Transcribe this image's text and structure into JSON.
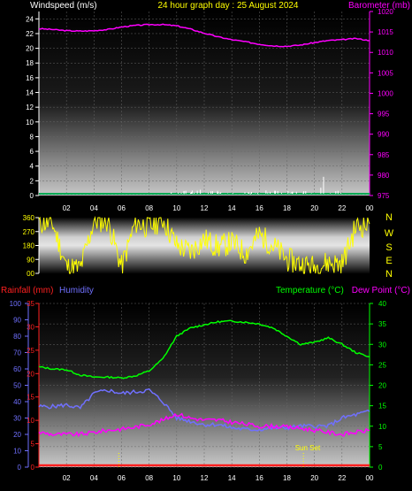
{
  "header": {
    "left": "Windspeed (m/s)",
    "center": "24 hour graph day : 25 August 2024",
    "right": "Barometer (mb)"
  },
  "compass_letters": [
    "N",
    "W",
    "S",
    "E",
    "N"
  ],
  "lower_labels": {
    "rainfall": "Rainfall (mm)",
    "humidity": "Humidity",
    "temperature": "Temperature (°C)",
    "dewpoint": "Dew Point (°C)"
  },
  "sunset_label": "Sun Set",
  "colors": {
    "wind": "#ffffff",
    "barometer": "#ff00ff",
    "direction": "#ffff00",
    "rainfall": "#ff2020",
    "humidity": "#7070ff",
    "temperature": "#00ff00",
    "dewpoint": "#ff00ff",
    "left_axis": "#ffffff",
    "grid": "#666666"
  },
  "chart_data": [
    {
      "type": "line",
      "title": "24 hour graph day : 25 August 2024",
      "x": [
        "00",
        "01",
        "02",
        "03",
        "04",
        "05",
        "06",
        "07",
        "08",
        "09",
        "10",
        "11",
        "12",
        "13",
        "14",
        "15",
        "16",
        "17",
        "18",
        "19",
        "20",
        "21",
        "22",
        "23",
        "00"
      ],
      "xticks": [
        "02",
        "04",
        "06",
        "08",
        "10",
        "12",
        "14",
        "16",
        "18",
        "20",
        "22",
        "00"
      ],
      "ylabel": "Windspeed (m/s)",
      "ylim": [
        0,
        25
      ],
      "yticks": [
        "0",
        "2",
        "4",
        "6",
        "8",
        "10",
        "12",
        "14",
        "16",
        "18",
        "20",
        "22",
        "24"
      ],
      "y2label": "Barometer (mb)",
      "y2lim": [
        975,
        1020
      ],
      "y2ticks": [
        "975",
        "980",
        "985",
        "990",
        "995",
        "1000",
        "1005",
        "1010",
        "1015",
        "1020"
      ],
      "series": [
        {
          "name": "Windspeed (m/s)",
          "axis": "left",
          "values": [
            0,
            0,
            0,
            0,
            0,
            0,
            0,
            0,
            0,
            0,
            0.5,
            0.6,
            0.5,
            0.4,
            0.5,
            0.4,
            0.6,
            0.8,
            0.5,
            0.6,
            2,
            0.5,
            0.3,
            0.2,
            0.2
          ]
        },
        {
          "name": "Barometer (mb)",
          "axis": "right",
          "values": [
            1015.8,
            1015.6,
            1015.3,
            1015.2,
            1015.3,
            1015.6,
            1016.2,
            1016.6,
            1016.8,
            1016.8,
            1016.5,
            1015.7,
            1014.7,
            1013.8,
            1013.1,
            1012.6,
            1012.0,
            1011.6,
            1011.5,
            1011.8,
            1012.4,
            1012.9,
            1013.1,
            1013.4,
            1012.9
          ]
        }
      ]
    },
    {
      "type": "line",
      "ylim": [
        0,
        360
      ],
      "yticks": [
        "00",
        "90",
        "180",
        "270",
        "360"
      ],
      "series": [
        {
          "name": "Wind direction",
          "values": [
            330,
            320,
            40,
            30,
            340,
            340,
            40,
            330,
            300,
            350,
            180,
            140,
            220,
            170,
            200,
            130,
            250,
            180,
            90,
            60,
            40,
            70,
            60,
            300,
            320
          ]
        }
      ]
    },
    {
      "type": "line",
      "xticks": [
        "02",
        "04",
        "06",
        "08",
        "10",
        "12",
        "14",
        "16",
        "18",
        "20",
        "22",
        "00"
      ],
      "humidity_axis": {
        "label": "Humidity",
        "ylim": [
          0,
          100
        ],
        "yticks": [
          "0",
          "10",
          "20",
          "30",
          "40",
          "50",
          "60",
          "70",
          "80",
          "90",
          "100"
        ]
      },
      "rainfall_axis": {
        "label": "Rainfall (mm)",
        "ylim": [
          0,
          35
        ],
        "yticks": [
          "0",
          "5",
          "10",
          "15",
          "20",
          "25",
          "30",
          "35"
        ]
      },
      "temperature_axis": {
        "label": "Temperature (°C)",
        "ylim": [
          0,
          40
        ],
        "yticks": [
          "0",
          "5",
          "10",
          "15",
          "20",
          "25",
          "30",
          "35",
          "40"
        ]
      },
      "series": [
        {
          "name": "Temperature (°C)",
          "axis": "temperature",
          "values": [
            24.5,
            24,
            23.8,
            22.5,
            22,
            22,
            21.8,
            22.3,
            23.5,
            26.5,
            32,
            34,
            34.8,
            35.5,
            35.7,
            35.4,
            35,
            34,
            32,
            30,
            30.5,
            31.6,
            30,
            28,
            27
          ]
        },
        {
          "name": "Dew Point (°C)",
          "axis": "temperature",
          "values": [
            8.5,
            8,
            8,
            8,
            8.5,
            9,
            9.3,
            9.8,
            10.5,
            11.5,
            13,
            12,
            11.5,
            11.5,
            11,
            10.5,
            10,
            10,
            9.8,
            9.5,
            9,
            8.5,
            8,
            8.5,
            9
          ]
        },
        {
          "name": "Humidity",
          "axis": "humidity",
          "values": [
            37,
            37,
            38,
            36,
            45,
            47,
            45,
            46,
            47,
            40,
            30,
            28,
            26,
            26,
            24,
            23,
            23,
            24,
            24,
            25,
            25,
            25,
            30,
            32,
            34
          ]
        },
        {
          "name": "Rainfall (mm)",
          "axis": "rainfall",
          "values": [
            0,
            0,
            0,
            0,
            0,
            0,
            0,
            0,
            0,
            0,
            0,
            0,
            0,
            0,
            0,
            0,
            0,
            0,
            0,
            0,
            0,
            0,
            0,
            0,
            0
          ]
        }
      ],
      "annotations": [
        {
          "text": "Sun Set"
        }
      ]
    }
  ]
}
